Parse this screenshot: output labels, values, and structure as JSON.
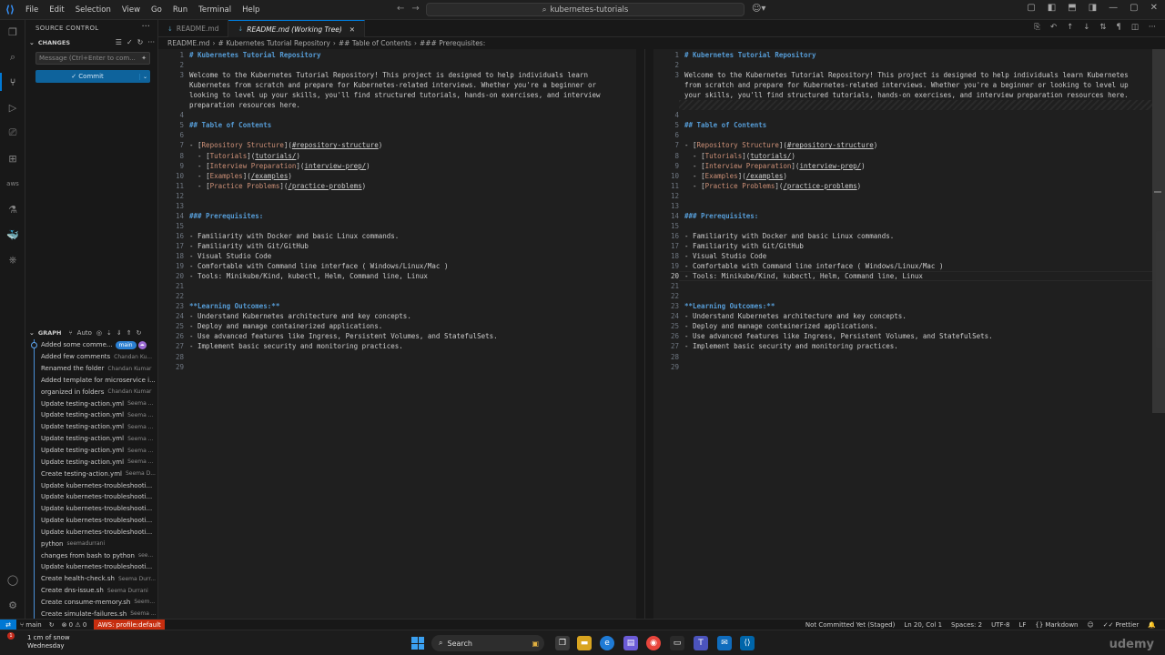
{
  "titlebar": {
    "menu": [
      "File",
      "Edit",
      "Selection",
      "View",
      "Go",
      "Run",
      "Terminal",
      "Help"
    ],
    "search": "kubernetes-tutorials"
  },
  "sidebar": {
    "title": "SOURCE CONTROL",
    "changes_label": "CHANGES",
    "message_placeholder": "Message (Ctrl+Enter to com...",
    "commit_label": "✓ Commit",
    "graph_label": "GRAPH",
    "graph_auto": "Auto",
    "graph": [
      {
        "msg": "Added some comme...",
        "author": "",
        "badge": "main"
      },
      {
        "msg": "Added few comments",
        "author": "Chandan Ku..."
      },
      {
        "msg": "Renamed the folder",
        "author": "Chandan Kumar"
      },
      {
        "msg": "Added template for microservice i...",
        "author": ""
      },
      {
        "msg": "organized in folders",
        "author": "Chandan Kumar"
      },
      {
        "msg": "Update testing-action.yml",
        "author": "Seema ..."
      },
      {
        "msg": "Update testing-action.yml",
        "author": "Seema ..."
      },
      {
        "msg": "Update testing-action.yml",
        "author": "Seema ..."
      },
      {
        "msg": "Update testing-action.yml",
        "author": "Seema ..."
      },
      {
        "msg": "Update testing-action.yml",
        "author": "Seema ..."
      },
      {
        "msg": "Update testing-action.yml",
        "author": "Seema ..."
      },
      {
        "msg": "Create testing-action.yml",
        "author": "Seema D..."
      },
      {
        "msg": "Update kubernetes-troubleshooti...",
        "author": ""
      },
      {
        "msg": "Update kubernetes-troubleshooti...",
        "author": ""
      },
      {
        "msg": "Update kubernetes-troubleshooti...",
        "author": ""
      },
      {
        "msg": "Update kubernetes-troubleshooti...",
        "author": ""
      },
      {
        "msg": "Update kubernetes-troubleshooti...",
        "author": ""
      },
      {
        "msg": "python",
        "author": "seemadurrani"
      },
      {
        "msg": "changes from bash to python",
        "author": "see..."
      },
      {
        "msg": "Update kubernetes-troubleshooti...",
        "author": ""
      },
      {
        "msg": "Create health-check.sh",
        "author": "Seema Durr..."
      },
      {
        "msg": "Create dns-issue.sh",
        "author": "Seema Durrani"
      },
      {
        "msg": "Create consume-memory.sh",
        "author": "Seem..."
      },
      {
        "msg": "Create simulate-failures.sh",
        "author": "Seema ..."
      }
    ]
  },
  "tabs": [
    {
      "label": "README.md",
      "active": false
    },
    {
      "label": "README.md (Working Tree)",
      "active": true
    }
  ],
  "breadcrumb": [
    "README.md",
    "# Kubernetes Tutorial Repository",
    "## Table of Contents",
    "### Prerequisites:"
  ],
  "left_lines": [
    {
      "n": "1",
      "t": "# Kubernetes Tutorial Repository",
      "k": "h"
    },
    {
      "n": "2",
      "t": "",
      "k": ""
    },
    {
      "n": "3",
      "t": "Welcome to the Kubernetes Tutorial Repository! This project is designed to help individuals learn",
      "k": ""
    },
    {
      "n": "",
      "t": "Kubernetes from scratch and prepare for Kubernetes-related interviews. Whether you're a beginner or",
      "k": ""
    },
    {
      "n": "",
      "t": "looking to level up your skills, you'll find structured tutorials, hands-on exercises, and interview",
      "k": ""
    },
    {
      "n": "",
      "t": "preparation resources here.",
      "k": ""
    },
    {
      "n": "4",
      "t": "",
      "k": ""
    },
    {
      "n": "5",
      "t": "## Table of Contents",
      "k": "h"
    },
    {
      "n": "6",
      "t": "",
      "k": ""
    },
    {
      "n": "7",
      "t": "- [Repository Structure](#repository-structure)",
      "k": "link"
    },
    {
      "n": "8",
      "t": "  - [Tutorials](tutorials/)",
      "k": "link"
    },
    {
      "n": "9",
      "t": "  - [Interview Preparation](interview-prep/)",
      "k": "link"
    },
    {
      "n": "10",
      "t": "  - [Examples](/examples)",
      "k": "link"
    },
    {
      "n": "11",
      "t": "  - [Practice Problems](/practice-problems)",
      "k": "link"
    },
    {
      "n": "12",
      "t": "",
      "k": ""
    },
    {
      "n": "13",
      "t": "",
      "k": ""
    },
    {
      "n": "14",
      "t": "### Prerequisites:",
      "k": "h"
    },
    {
      "n": "15",
      "t": "",
      "k": ""
    },
    {
      "n": "16",
      "t": "- Familiarity with Docker and basic Linux commands.",
      "k": ""
    },
    {
      "n": "17",
      "t": "- Familiarity with Git/GitHub",
      "k": ""
    },
    {
      "n": "18",
      "t": "- Visual Studio Code",
      "k": ""
    },
    {
      "n": "19",
      "t": "- Comfortable with Command line interface ( Windows/Linux/Mac )",
      "k": ""
    },
    {
      "n": "20",
      "t": "- Tools: Minikube/Kind, kubectl, Helm, Command line, Linux",
      "k": ""
    },
    {
      "n": "21",
      "t": "",
      "k": ""
    },
    {
      "n": "22",
      "t": "",
      "k": ""
    },
    {
      "n": "23",
      "t": "**Learning Outcomes:**",
      "k": "bold"
    },
    {
      "n": "24",
      "t": "- Understand Kubernetes architecture and key concepts.",
      "k": ""
    },
    {
      "n": "25",
      "t": "- Deploy and manage containerized applications.",
      "k": ""
    },
    {
      "n": "26",
      "t": "- Use advanced features like Ingress, Persistent Volumes, and StatefulSets.",
      "k": ""
    },
    {
      "n": "27",
      "t": "- Implement basic security and monitoring practices.",
      "k": ""
    },
    {
      "n": "28",
      "t": "",
      "k": ""
    },
    {
      "n": "29",
      "t": "",
      "k": ""
    }
  ],
  "right_lines": [
    {
      "n": "1",
      "t": "# Kubernetes Tutorial Repository",
      "k": "h"
    },
    {
      "n": "2",
      "t": "",
      "k": ""
    },
    {
      "n": "3",
      "t": "Welcome to the Kubernetes Tutorial Repository! This project is designed to help individuals learn Kubernetes",
      "k": ""
    },
    {
      "n": "",
      "t": "from scratch and prepare for Kubernetes-related interviews. Whether you're a beginner or looking to level up",
      "k": ""
    },
    {
      "n": "",
      "t": "your skills, you'll find structured tutorials, hands-on exercises, and interview preparation resources here.",
      "k": ""
    },
    {
      "n": "",
      "t": "",
      "k": "hatch"
    },
    {
      "n": "4",
      "t": "",
      "k": ""
    },
    {
      "n": "5",
      "t": "## Table of Contents",
      "k": "h"
    },
    {
      "n": "6",
      "t": "",
      "k": ""
    },
    {
      "n": "7",
      "t": "- [Repository Structure](#repository-structure)",
      "k": "link"
    },
    {
      "n": "8",
      "t": "  - [Tutorials](tutorials/)",
      "k": "link"
    },
    {
      "n": "9",
      "t": "  - [Interview Preparation](interview-prep/)",
      "k": "link"
    },
    {
      "n": "10",
      "t": "  - [Examples](/examples)",
      "k": "link"
    },
    {
      "n": "11",
      "t": "  - [Practice Problems](/practice-problems)",
      "k": "link"
    },
    {
      "n": "12",
      "t": "",
      "k": ""
    },
    {
      "n": "13",
      "t": "",
      "k": ""
    },
    {
      "n": "14",
      "t": "### Prerequisites:",
      "k": "h"
    },
    {
      "n": "15",
      "t": "",
      "k": ""
    },
    {
      "n": "16",
      "t": "- Familiarity with Docker and basic Linux commands.",
      "k": ""
    },
    {
      "n": "17",
      "t": "- Familiarity with Git/GitHub",
      "k": ""
    },
    {
      "n": "18",
      "t": "- Visual Studio Code",
      "k": ""
    },
    {
      "n": "19",
      "t": "- Comfortable with Command line interface ( Windows/Linux/Mac )",
      "k": ""
    },
    {
      "n": "20",
      "t": "- Tools: Minikube/Kind, kubectl, Helm, Command line, Linux",
      "k": "cur"
    },
    {
      "n": "21",
      "t": "",
      "k": ""
    },
    {
      "n": "22",
      "t": "",
      "k": ""
    },
    {
      "n": "23",
      "t": "**Learning Outcomes:**",
      "k": "bold"
    },
    {
      "n": "24",
      "t": "- Understand Kubernetes architecture and key concepts.",
      "k": ""
    },
    {
      "n": "25",
      "t": "- Deploy and manage containerized applications.",
      "k": ""
    },
    {
      "n": "26",
      "t": "- Use advanced features like Ingress, Persistent Volumes, and StatefulSets.",
      "k": ""
    },
    {
      "n": "27",
      "t": "- Implement basic security and monitoring practices.",
      "k": ""
    },
    {
      "n": "28",
      "t": "",
      "k": ""
    },
    {
      "n": "29",
      "t": "",
      "k": ""
    }
  ],
  "statusbar": {
    "branch": "main",
    "problems": "⊗ 0 ⚠ 0",
    "aws": "AWS: profile:default",
    "git_status": "Not Committed Yet (Staged)",
    "position": "Ln 20, Col 1",
    "spaces": "Spaces: 2",
    "encoding": "UTF-8",
    "eol": "LF",
    "language": "Markdown",
    "formatter": "Prettier"
  },
  "taskbar": {
    "weather_line1": "1 cm of snow",
    "weather_line2": "Wednesday",
    "weather_badge": "1",
    "search": "Search",
    "watermark": "udemy"
  }
}
